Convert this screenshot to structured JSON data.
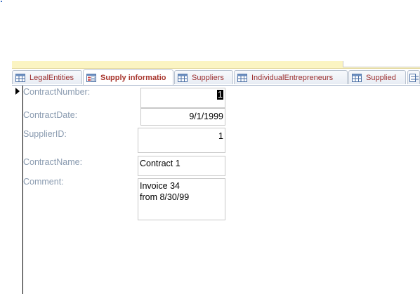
{
  "tabs": [
    {
      "label": "LegalEntities",
      "icon": "table-icon",
      "active": false
    },
    {
      "label": "Supply informatio",
      "icon": "form-icon",
      "active": true
    },
    {
      "label": "Suppliers",
      "icon": "table-icon",
      "active": false
    },
    {
      "label": "IndividualEntrepreneurs",
      "icon": "table-icon",
      "active": false
    },
    {
      "label": "Supplied",
      "icon": "table-icon",
      "active": false
    }
  ],
  "form": {
    "contract_number_label": "ContractNumber:",
    "contract_number_value": "1",
    "contract_date_label": "ContractDate:",
    "contract_date_value": "9/1/1999",
    "supplier_id_label": "SupplierID:",
    "supplier_id_value": "1",
    "contract_name_label": "ContractName:",
    "contract_name_value": "Contract 1",
    "comment_label": "Comment:",
    "comment_line1": "Invoice 34",
    "comment_line2": "from 8/30/99"
  },
  "colors": {
    "tab_text": "#9c2f2f",
    "label_text": "#8a9bb0",
    "ribbon": "#fbf4c2"
  }
}
